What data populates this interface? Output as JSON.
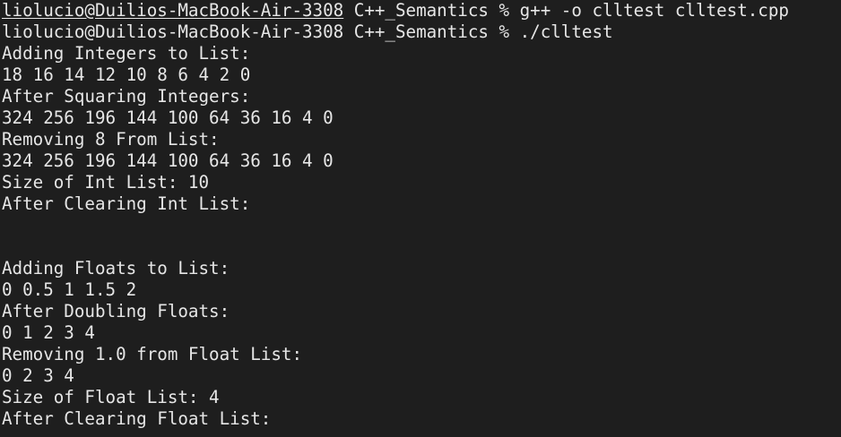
{
  "terminal": {
    "prompt1": {
      "user_host": "liolucio@Duilios-MacBook-Air-3308",
      "rest": " C++_Semantics % g++ -o clltest clltest.cpp"
    },
    "prompt2": {
      "user_host": "liolucio@Duilios-MacBook-Air-3308",
      "rest": " C++_Semantics % ./clltest"
    },
    "output": [
      "Adding Integers to List:",
      "18 16 14 12 10 8 6 4 2 0",
      "After Squaring Integers:",
      "324 256 196 144 100 64 36 16 4 0",
      "Removing 8 From List:",
      "324 256 196 144 100 64 36 16 4 0",
      "Size of Int List: 10",
      "After Clearing Int List:",
      "",
      "",
      "Adding Floats to List:",
      "0 0.5 1 1.5 2",
      "After Doubling Floats:",
      "0 1 2 3 4",
      "Removing 1.0 from Float List:",
      "0 2 3 4",
      "Size of Float List: 4",
      "After Clearing Float List:"
    ]
  },
  "colors": {
    "background": "#1e1e1e",
    "text": "#e6e6e6"
  }
}
